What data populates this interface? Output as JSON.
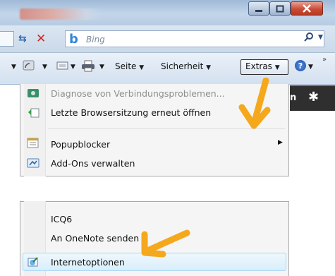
{
  "toolbar": {
    "search_placeholder": "Bing",
    "seite_label": "Seite",
    "sicherheit_label": "Sicherheit",
    "extras_label": "Extras"
  },
  "page_strip": {
    "partial_text": "n"
  },
  "menu": {
    "items_top": [
      {
        "label": "Diagnose von Verbindungsproblemen...",
        "icon": "diagnose-icon",
        "disabled": true
      },
      {
        "label": "Letzte Browsersitzung erneut öffnen",
        "icon": "reopen-session-icon"
      },
      {
        "label": "Popupblocker",
        "icon": "popupblocker-icon",
        "submenu": true
      },
      {
        "label": "Add-Ons verwalten",
        "icon": "addons-icon"
      }
    ],
    "items_bottom": [
      {
        "label": "ICQ6"
      },
      {
        "label": "An OneNote senden"
      },
      {
        "label": "Internetoptionen",
        "icon": "internet-options-icon",
        "highlighted": true
      }
    ]
  },
  "colors": {
    "arrow": "#f5a81c",
    "highlight": "#d9eefb",
    "close_button": "#c94c36"
  }
}
